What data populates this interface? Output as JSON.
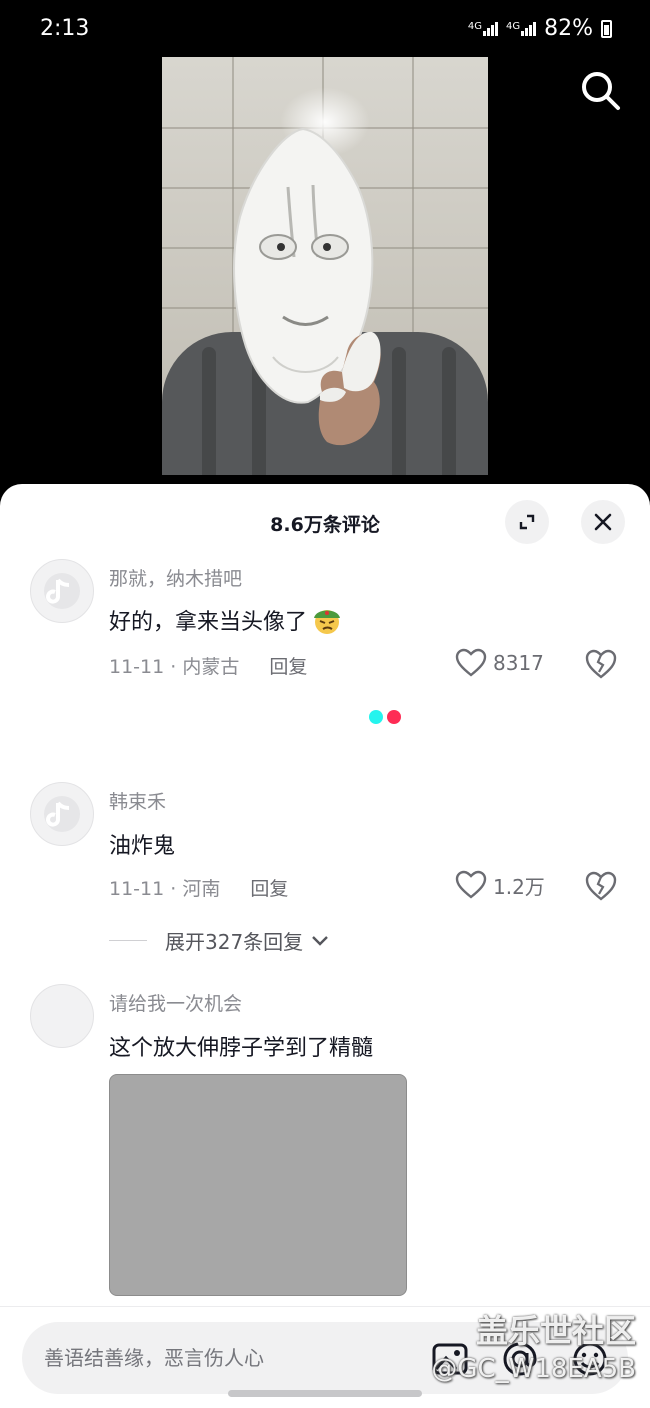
{
  "status_bar": {
    "time": "2:13",
    "net1": "4G",
    "net2": "4G",
    "battery": "82%"
  },
  "comments_header": {
    "title": "8.6万条评论"
  },
  "comments": [
    {
      "user": "那就，纳木措吧",
      "text": "好的，拿来当头像了",
      "date": "11-11 · 内蒙古",
      "reply": "回复",
      "likes": "8317"
    },
    {
      "user": "韩束禾",
      "text": "油炸鬼",
      "date": "11-11 · 河南",
      "reply": "回复",
      "likes": "1.2万",
      "expand_replies": "展开327条回复"
    },
    {
      "user": "请给我一次机会",
      "text": "这个放大伸脖子学到了精髓"
    }
  ],
  "input": {
    "placeholder": "善语结善缘，恶言伤人心"
  },
  "watermark": {
    "line1": "盖乐世社区",
    "line2": "@GC_W18EA5B"
  },
  "colors": {
    "dot_cyan": "#25f4ee",
    "dot_red": "#fe2c55",
    "emoji_face": "#f5c84c",
    "emoji_hat": "#4c9a3c"
  }
}
